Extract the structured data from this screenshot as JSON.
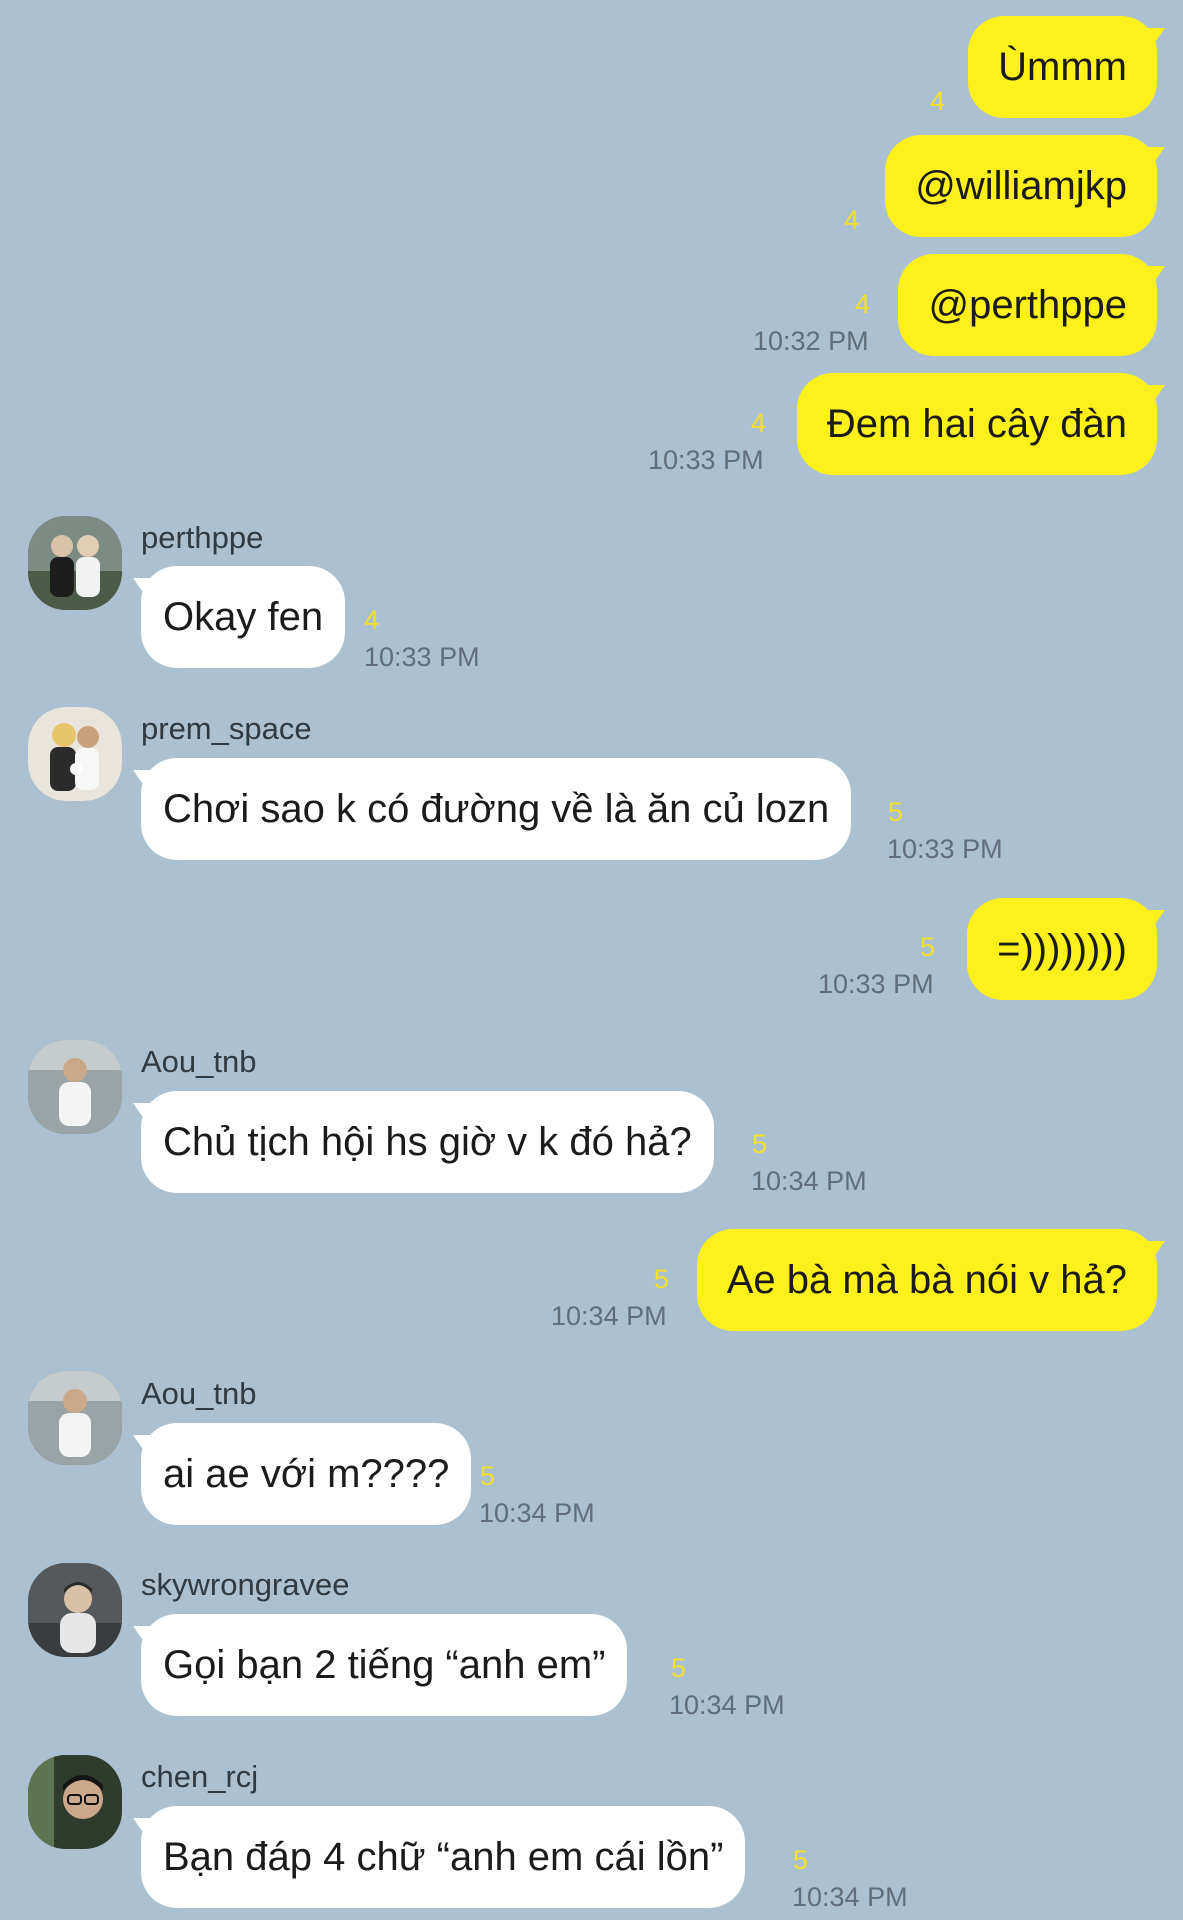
{
  "colors": {
    "background": "#abc1d1",
    "outgoing_bubble": "#fef01b",
    "incoming_bubble": "#ffffff",
    "unread_count": "#f3e02a",
    "timestamp": "#5f6e7a"
  },
  "messages": [
    {
      "text": "Ùmmm",
      "count": "4",
      "time": ""
    },
    {
      "text": "@williamjkp",
      "count": "4",
      "time": ""
    },
    {
      "text": "@perthppe",
      "count": "4",
      "time": "10:32 PM"
    },
    {
      "text": "Đem hai cây đàn",
      "count": "4",
      "time": "10:33 PM"
    },
    {
      "sender": "perthppe",
      "avatar_icon": "user-avatar-icon",
      "text": "Okay fen",
      "count": "4",
      "time": "10:33 PM"
    },
    {
      "sender": "prem_space",
      "avatar_icon": "user-avatar-icon",
      "text": "Chơi sao k có đường về là ăn củ lozn",
      "count": "5",
      "time": "10:33 PM"
    },
    {
      "text": "=))))))))",
      "count": "5",
      "time": "10:33 PM"
    },
    {
      "sender": "Aou_tnb",
      "avatar_icon": "user-avatar-icon",
      "text": "Chủ tịch hội hs giờ v k đó hả?",
      "count": "5",
      "time": "10:34 PM"
    },
    {
      "text": "Ae bà mà bà nói v hả?",
      "count": "5",
      "time": "10:34 PM"
    },
    {
      "sender": "Aou_tnb",
      "avatar_icon": "user-avatar-icon",
      "text": "ai ae với m????",
      "count": "5",
      "time": "10:34 PM"
    },
    {
      "sender": "skywrongravee",
      "avatar_icon": "user-avatar-icon",
      "text": "Gọi bạn 2 tiếng “anh em”",
      "count": "5",
      "time": "10:34 PM"
    },
    {
      "sender": "chen_rcj",
      "avatar_icon": "user-avatar-icon",
      "text": "Bạn đáp 4 chữ “anh em cái lồn”",
      "count": "5",
      "time": "10:34 PM"
    }
  ]
}
